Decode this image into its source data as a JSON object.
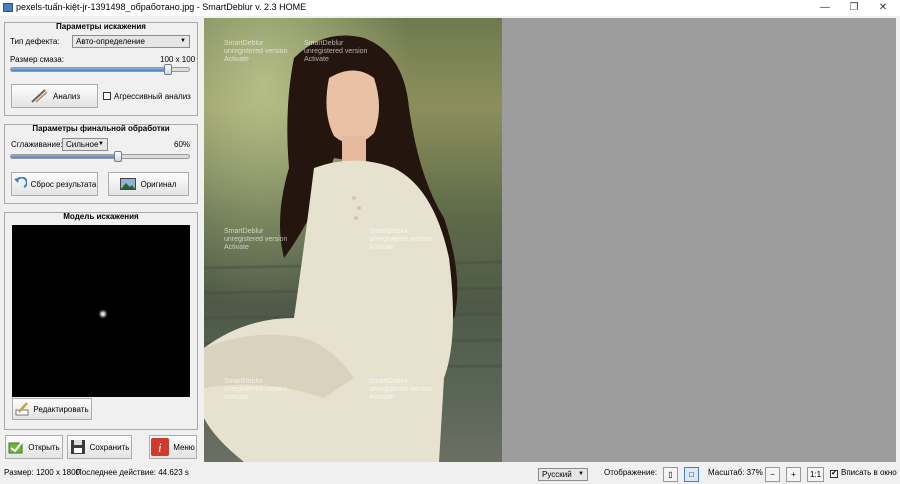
{
  "window": {
    "title": "pexels-tuấn-kiệt-jr-1391498_обработано.jpg - SmartDeblur v. 2.3 HOME",
    "minimize_icon": "minimize-icon",
    "maximize_icon": "restore-icon",
    "close_icon": "close-icon"
  },
  "distortion": {
    "title": "Параметры искажения",
    "defect_label": "Тип дефекта:",
    "defect_value": "Авто-определение",
    "blur_label": "Размер смаза:",
    "blur_value": "100 x 100",
    "blur_fraction": 0.88,
    "analyze_label": "Анализ",
    "aggressive_label": "Агрессивный анализ",
    "aggressive_checked": false
  },
  "final": {
    "title": "Параметры финальной обработки",
    "smooth_label": "Сглаживание:",
    "smooth_value": "Сильное",
    "smooth_percent": "60%",
    "smooth_fraction": 0.6,
    "reset_label": "Сброс результата",
    "original_label": "Оригинал"
  },
  "model": {
    "title": "Модель искажения",
    "edit_label": "Редактировать"
  },
  "bottom": {
    "open_label": "Открыть",
    "save_label": "Сохранить",
    "menu_label": "Меню"
  },
  "watermark": {
    "brand": "SmartDeblur",
    "subtext": "unregistered version",
    "action": "Activate"
  },
  "status": {
    "size": "Размер: 1200 x 1800",
    "last_action": "Последнее действие: 44.623 s",
    "language": "Русский",
    "display_label": "Отображение:",
    "zoom_label": "Масштаб: 37%",
    "zoom_1to1": "1:1",
    "fit_label": "Вписать в окно",
    "fit_checked": true
  }
}
